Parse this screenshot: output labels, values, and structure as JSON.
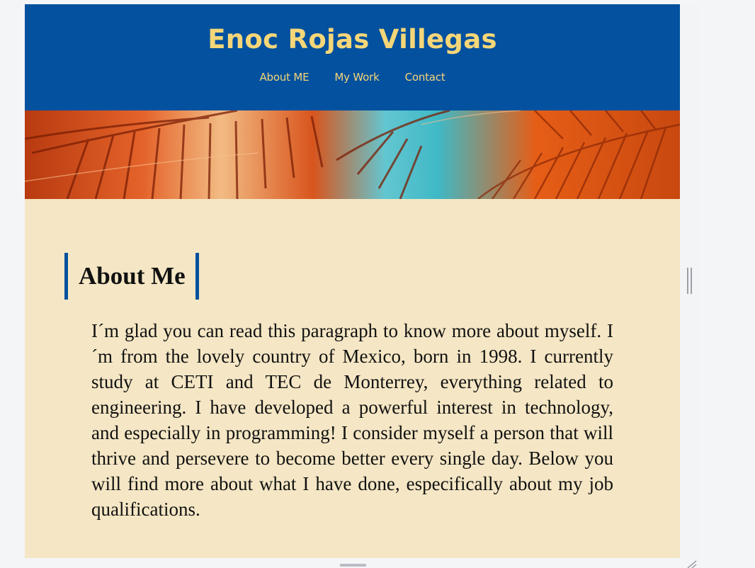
{
  "site": {
    "title": "Enoc Rojas Villegas",
    "nav": [
      {
        "label": "About ME"
      },
      {
        "label": "My Work"
      },
      {
        "label": "Contact"
      }
    ]
  },
  "hero": {
    "image": "palm-leaves-sunset-photo"
  },
  "about": {
    "heading": "About Me",
    "paragraph": "I´m glad you can read this paragraph to know more about myself. I´m from the lovely country of Mexico, born in 1998. I currently study at CETI and TEC de Monterrey, everything related to engineering. I have developed a powerful interest in technology, and especially in programming! I consider myself a person that will thrive and persevere to become better every single day. Below you will find more about what I have done, especifically about my job qualifications."
  },
  "colors": {
    "header_bg": "#03519f",
    "accent_text": "#f5d678",
    "content_bg": "#f5e7c5",
    "heading_border": "#03519f"
  }
}
